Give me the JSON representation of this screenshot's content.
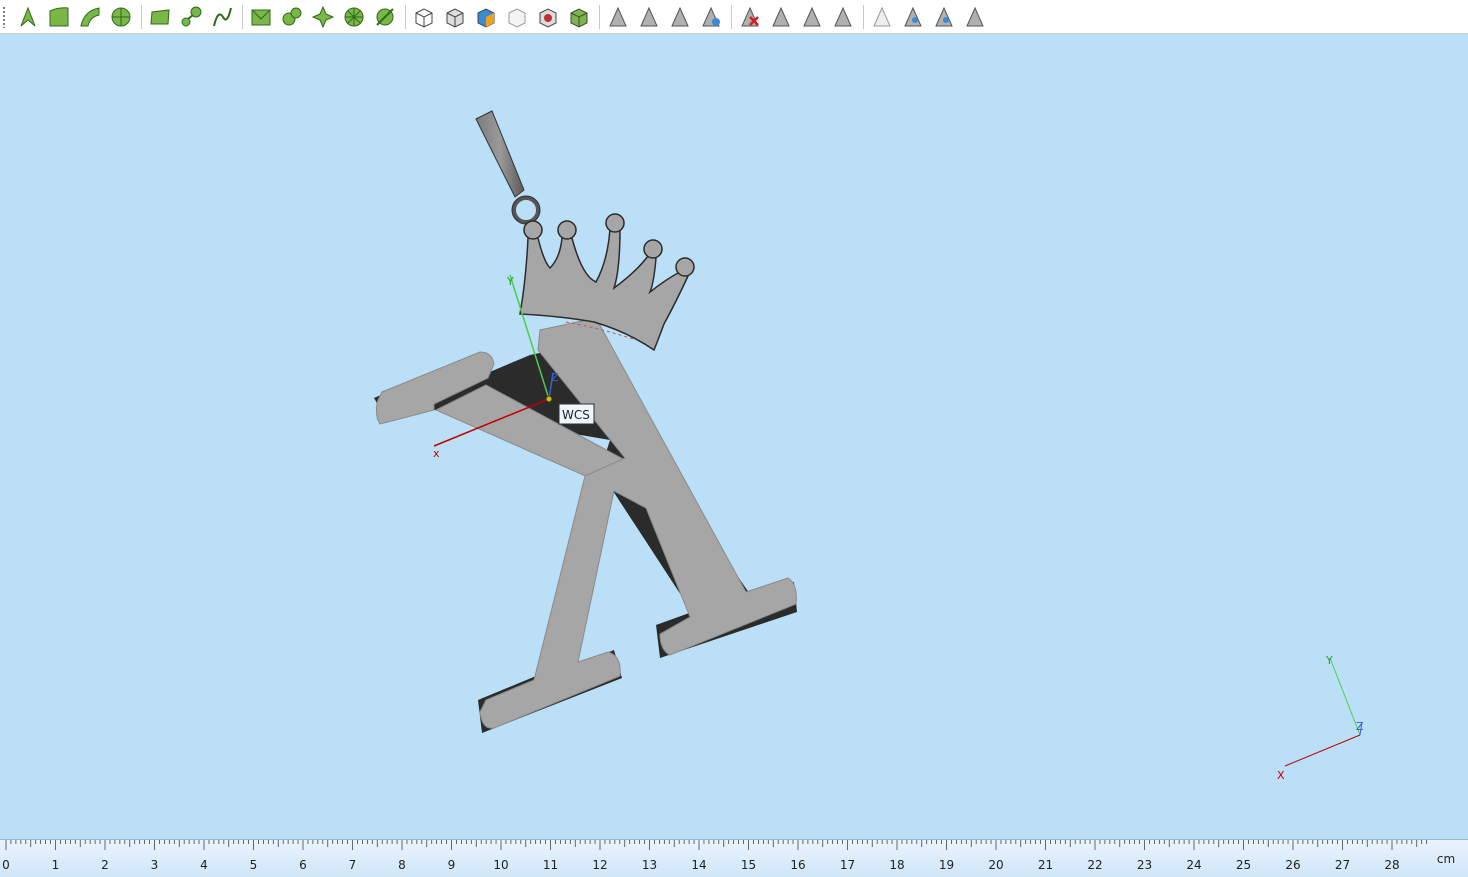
{
  "toolbar": {
    "buttons": [
      {
        "name": "select-arrow-icon",
        "kind": "arrow",
        "group": 0
      },
      {
        "name": "select-surface-icon",
        "kind": "surface",
        "group": 0
      },
      {
        "name": "select-curve-icon",
        "kind": "curve",
        "group": 0
      },
      {
        "name": "select-solid-icon",
        "kind": "solid",
        "group": 0
      },
      {
        "name": "plane-surface-icon",
        "kind": "plane",
        "group": 1
      },
      {
        "name": "loft-surface-icon",
        "kind": "loft",
        "group": 1
      },
      {
        "name": "sweep-surface-icon",
        "kind": "sweep",
        "group": 1
      },
      {
        "name": "mesh-surface-icon",
        "kind": "mesh",
        "group": 2
      },
      {
        "name": "blend-surface-icon",
        "kind": "blend",
        "group": 2
      },
      {
        "name": "star-surface-icon",
        "kind": "star",
        "group": 2
      },
      {
        "name": "radial-surface-icon",
        "kind": "radial",
        "group": 2
      },
      {
        "name": "cut-surface-icon",
        "kind": "cut",
        "group": 2
      },
      {
        "name": "box-solid-icon",
        "kind": "box",
        "group": 3
      },
      {
        "name": "box-shaded-icon",
        "kind": "box2",
        "group": 3
      },
      {
        "name": "box-highlight-icon",
        "kind": "box3",
        "group": 3
      },
      {
        "name": "box-wire-icon",
        "kind": "box4",
        "group": 3
      },
      {
        "name": "box-intersect-icon",
        "kind": "box5",
        "group": 3
      },
      {
        "name": "box-green-icon",
        "kind": "box6",
        "group": 3
      },
      {
        "name": "facet-arrow-icon",
        "kind": "gray1",
        "group": 4
      },
      {
        "name": "facet-split-icon",
        "kind": "gray2",
        "group": 4
      },
      {
        "name": "facet-merge-icon",
        "kind": "gray3",
        "group": 4
      },
      {
        "name": "facet-blue-icon",
        "kind": "gray4",
        "group": 4
      },
      {
        "name": "delete-facet-icon",
        "kind": "gray5",
        "group": 5
      },
      {
        "name": "facet-grid-icon",
        "kind": "gray6",
        "group": 5
      },
      {
        "name": "facet-copy-icon",
        "kind": "gray7",
        "group": 5
      },
      {
        "name": "facet-slice-icon",
        "kind": "gray8",
        "group": 5
      },
      {
        "name": "hide-facet-icon",
        "kind": "gray9",
        "group": 6
      },
      {
        "name": "show-facet-icon",
        "kind": "gray10",
        "group": 6
      },
      {
        "name": "isolate-facet-icon",
        "kind": "gray11",
        "group": 6
      },
      {
        "name": "facet-box-icon",
        "kind": "gray12",
        "group": 6
      }
    ]
  },
  "viewport": {
    "background": "#bcdff8",
    "model_color": "#a8a8a8",
    "wcs_label": "WCS",
    "local_axes": {
      "x": "x",
      "y": "Y",
      "z": "Z"
    },
    "corner_axes": {
      "x": "X",
      "y": "Y",
      "z": "Z"
    }
  },
  "ruler": {
    "labels": [
      "0",
      "1",
      "2",
      "3",
      "4",
      "5",
      "6",
      "7",
      "8",
      "9",
      "10",
      "11",
      "12",
      "13",
      "14",
      "15",
      "16",
      "17",
      "18",
      "19",
      "20",
      "21",
      "22",
      "23",
      "24",
      "25",
      "26",
      "27",
      "28"
    ],
    "unit": "cm"
  }
}
